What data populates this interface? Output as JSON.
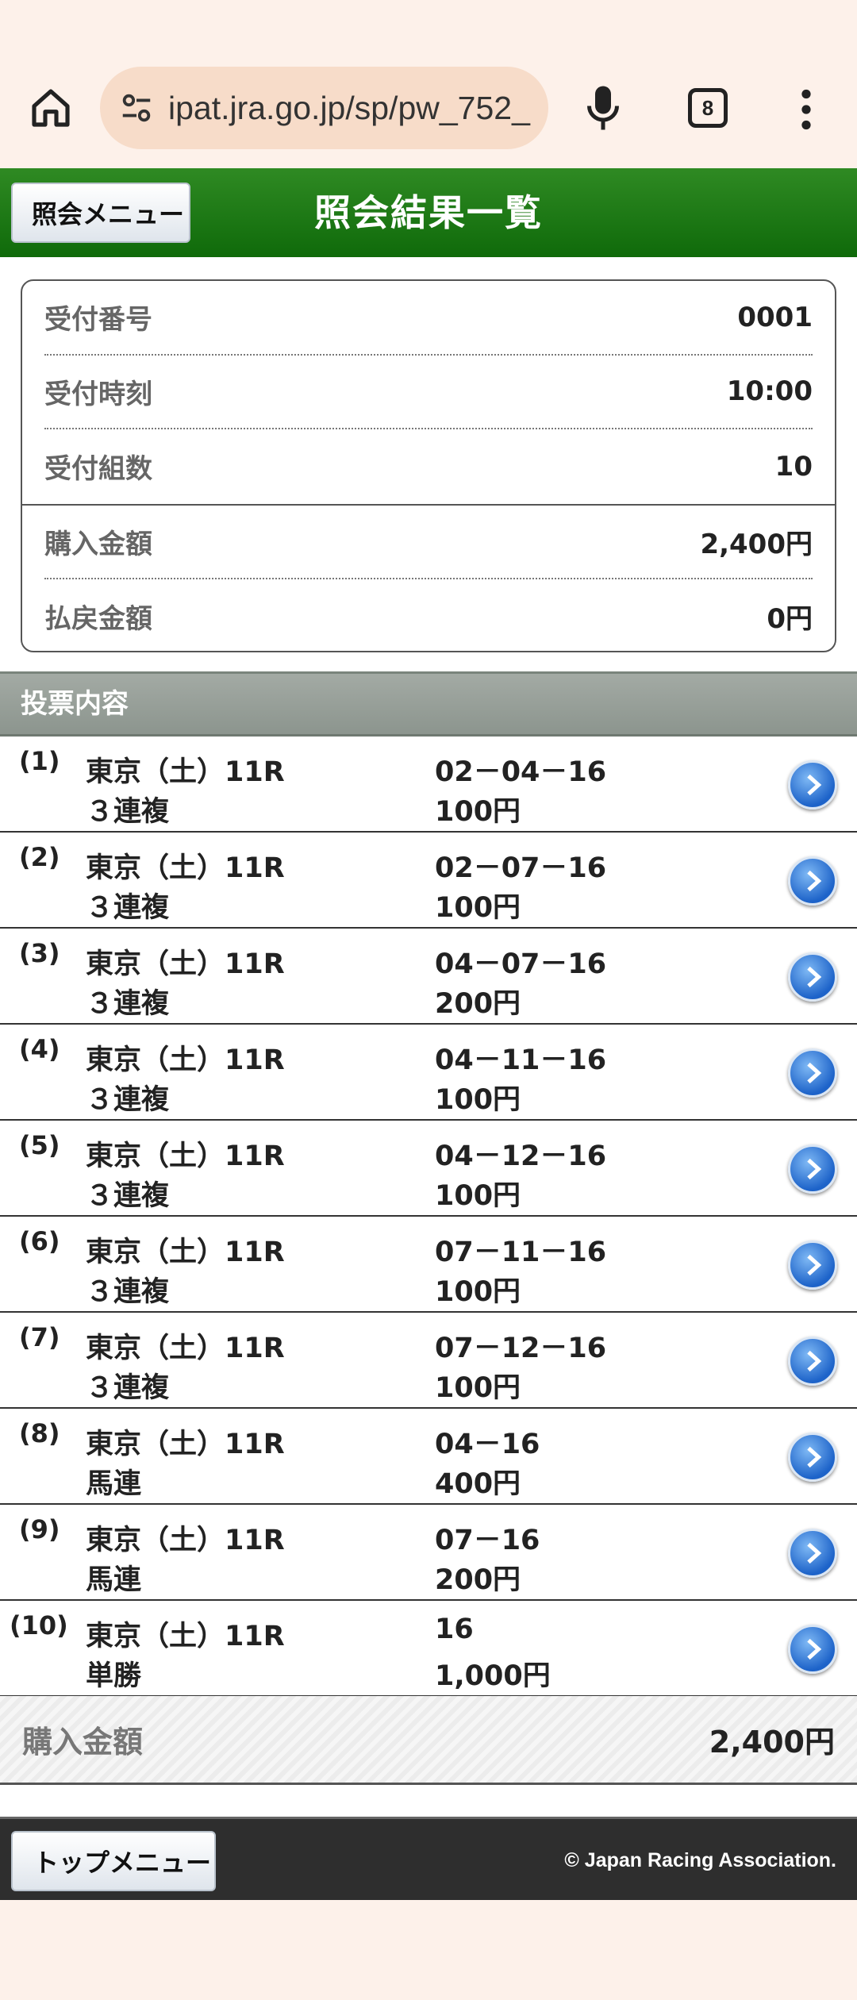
{
  "browser": {
    "url": "ipat.jra.go.jp/sp/pw_752_",
    "tab_count": "8",
    "icons": [
      "home-icon",
      "tune-icon",
      "mic-icon",
      "tabs-icon",
      "more-icon"
    ]
  },
  "header": {
    "back_label": "照会メニュー",
    "title": "照会結果一覧"
  },
  "info": {
    "receipt_no_label": "受付番号",
    "receipt_no": "0001",
    "receipt_time_label": "受付時刻",
    "receipt_time": "10:00",
    "sets_label": "受付組数",
    "sets": "10",
    "purchase_label": "購入金額",
    "purchase": "2,400円",
    "refund_label": "払戻金額",
    "refund": "0円"
  },
  "section_title": "投票内容",
  "bets": [
    {
      "no": "(1)",
      "race": "東京（土）11R",
      "type": "３連複",
      "combo": "02－04－16",
      "amount": "100円"
    },
    {
      "no": "(2)",
      "race": "東京（土）11R",
      "type": "３連複",
      "combo": "02－07－16",
      "amount": "100円"
    },
    {
      "no": "(3)",
      "race": "東京（土）11R",
      "type": "３連複",
      "combo": "04－07－16",
      "amount": "200円"
    },
    {
      "no": "(4)",
      "race": "東京（土）11R",
      "type": "３連複",
      "combo": "04－11－16",
      "amount": "100円"
    },
    {
      "no": "(5)",
      "race": "東京（土）11R",
      "type": "３連複",
      "combo": "04－12－16",
      "amount": "100円"
    },
    {
      "no": "(6)",
      "race": "東京（土）11R",
      "type": "３連複",
      "combo": "07－11－16",
      "amount": "100円"
    },
    {
      "no": "(7)",
      "race": "東京（土）11R",
      "type": "３連複",
      "combo": "07－12－16",
      "amount": "100円"
    },
    {
      "no": "(8)",
      "race": "東京（土）11R",
      "type": "馬連",
      "combo": "04－16",
      "amount": "400円"
    },
    {
      "no": "(9)",
      "race": "東京（土）11R",
      "type": "馬連",
      "combo": "07－16",
      "amount": "200円"
    },
    {
      "no": "(10)",
      "race": "東京（土）11R",
      "type": "単勝",
      "combo": "16",
      "amount": "1,000円"
    }
  ],
  "total": {
    "label": "購入金額",
    "value": "2,400円"
  },
  "footer": {
    "top_menu_label": "トップメニュー",
    "copyright": "© Japan Racing Association."
  }
}
